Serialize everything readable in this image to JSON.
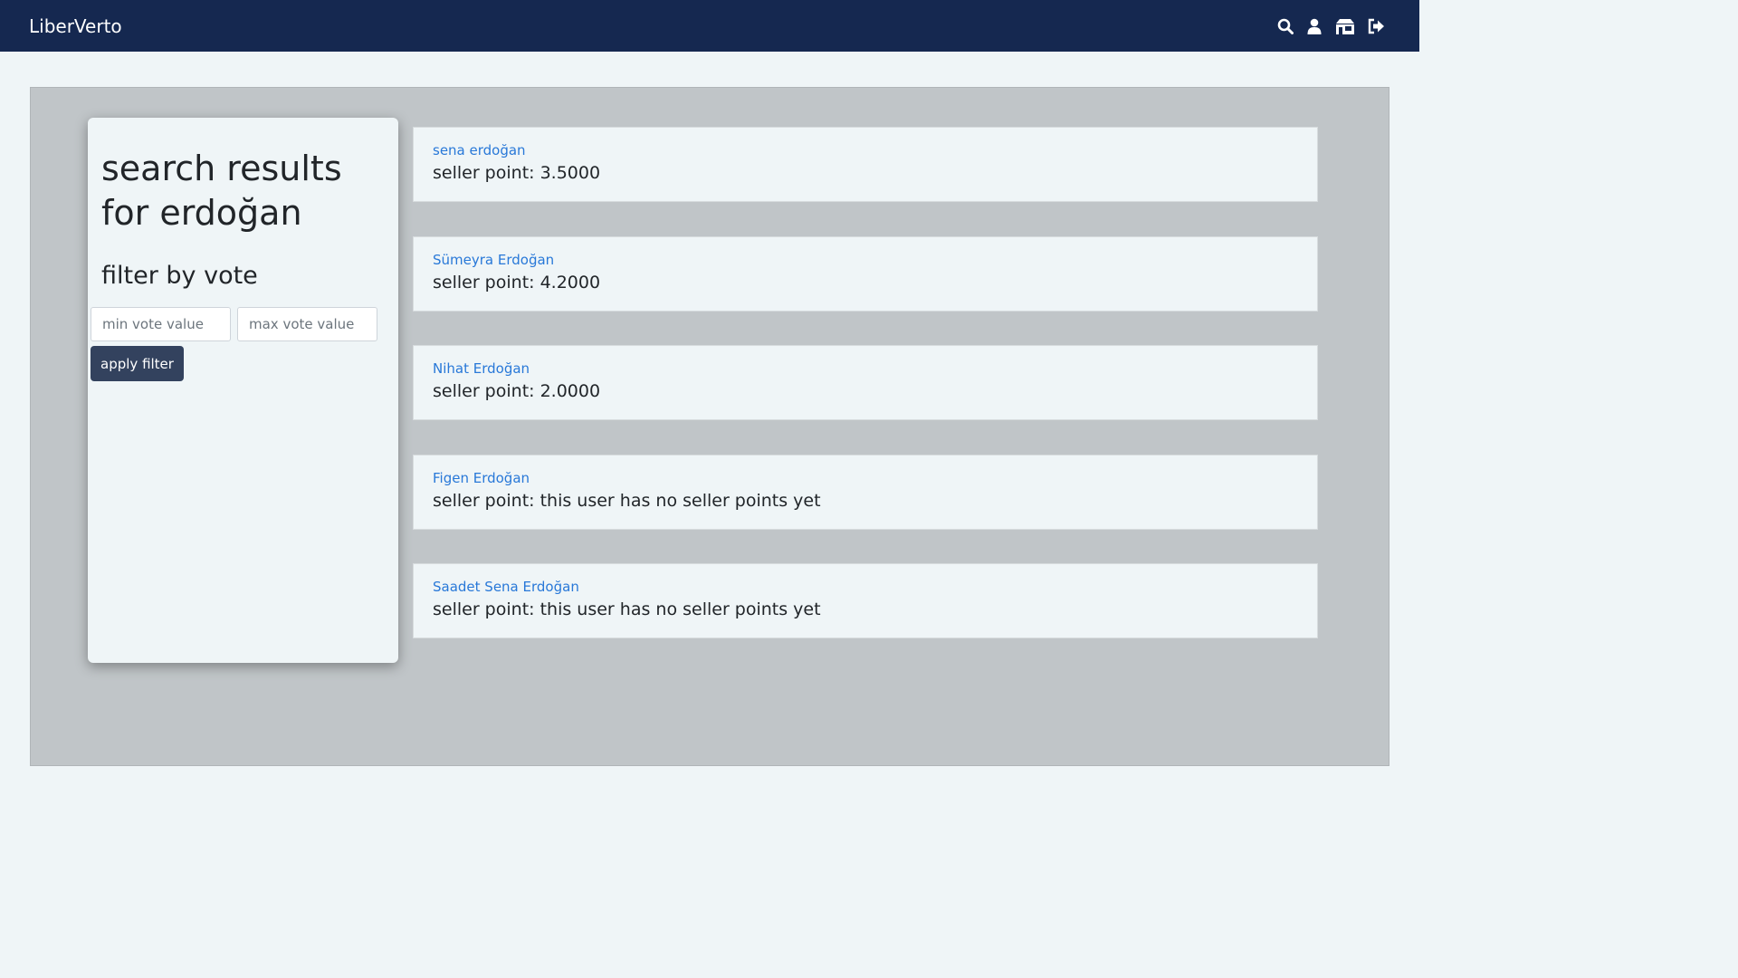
{
  "navbar": {
    "brand": "LiberVerto",
    "icons": [
      "search-icon",
      "user-icon",
      "store-icon",
      "logout-icon"
    ]
  },
  "sidebar": {
    "title": "search results for erdoğan",
    "filter_title": "filter by vote",
    "min_placeholder": "min vote value",
    "max_placeholder": "max vote value",
    "apply_label": "apply filter"
  },
  "results": [
    {
      "name": "sena erdoğan",
      "points": "seller point: 3.5000"
    },
    {
      "name": "Sümeyra Erdoğan",
      "points": "seller point: 4.2000"
    },
    {
      "name": "Nihat Erdoğan",
      "points": "seller point: 2.0000"
    },
    {
      "name": "Figen Erdoğan",
      "points": "seller point: this user has no seller points yet"
    },
    {
      "name": "Saadet Sena Erdoğan",
      "points": "seller point: this user has no seller points yet"
    }
  ],
  "colors": {
    "navbar_bg": "#152850",
    "panel_bg": "#c0c5c8",
    "link": "#2878d8",
    "button_bg": "#33425e"
  }
}
